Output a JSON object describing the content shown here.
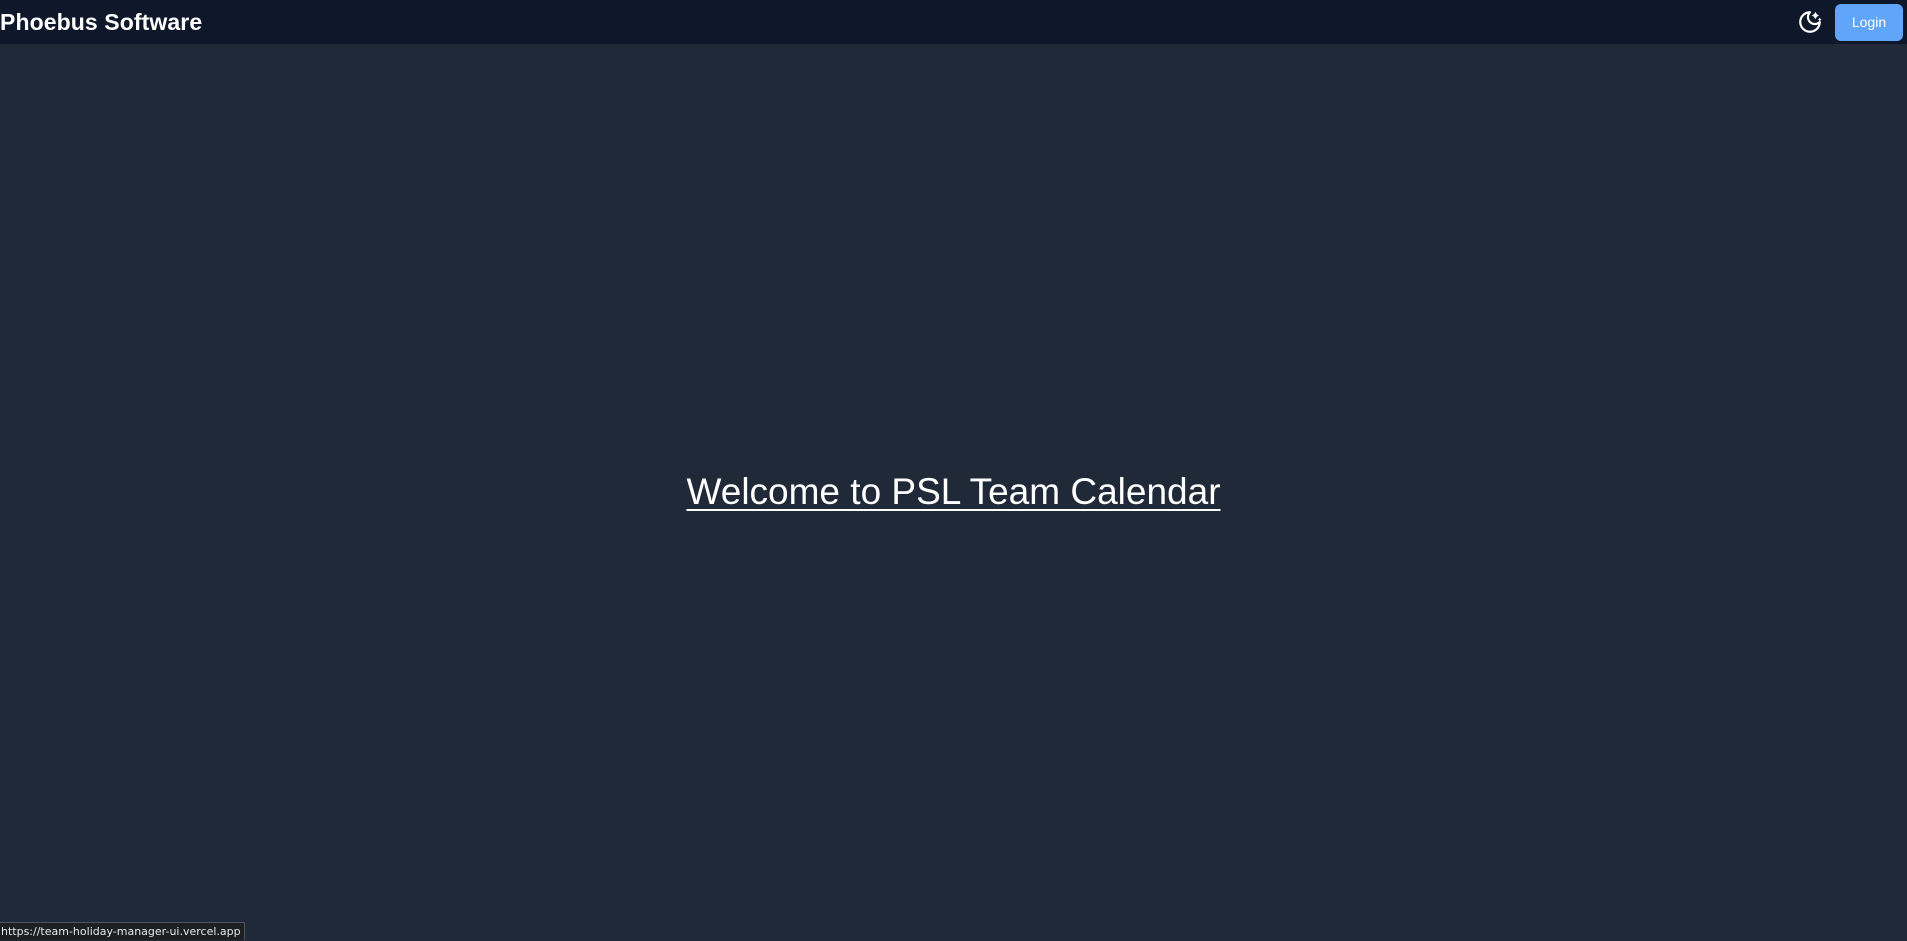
{
  "header": {
    "brand": "Phoebus Software",
    "theme_toggle_icon": "moon-stars-icon",
    "login_label": "Login",
    "accent_color": "#60a5fa"
  },
  "main": {
    "welcome_text": "Welcome to PSL Team Calendar"
  },
  "status_bar": {
    "url": "https://team-holiday-manager-ui.vercel.app"
  },
  "colors": {
    "topbar_bg": "#0f172a",
    "page_bg": "#1f2937",
    "text": "#ffffff"
  }
}
